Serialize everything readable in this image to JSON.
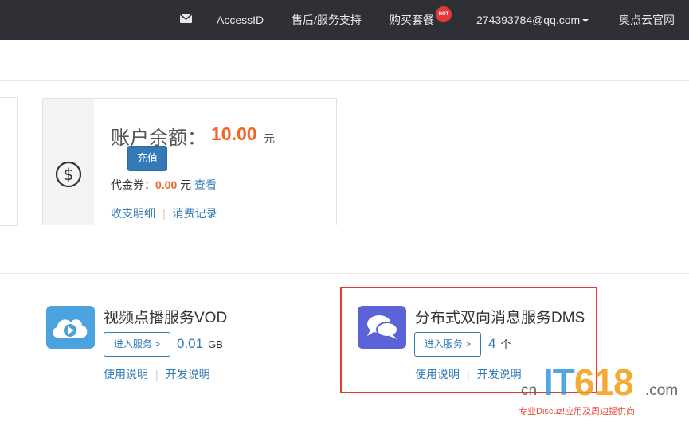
{
  "nav": {
    "mail_icon": "envelope-icon",
    "access_id": "AccessID",
    "support": "售后/服务支持",
    "buy": "购买套餐",
    "hot_badge": "HOT",
    "account": "274393784@qq.com",
    "official_site": "奥点云官网"
  },
  "balance": {
    "icon": "dollar-circle-icon",
    "label": "账户余额：",
    "amount": "10.00",
    "unit": "元",
    "recharge": "充值",
    "voucher_label": "代金券：",
    "voucher_amount": "0.00",
    "voucher_unit": "元",
    "voucher_view": "查看",
    "income_detail": "收支明细",
    "consume_record": "消费记录"
  },
  "services": [
    {
      "icon": "cloud-play-icon",
      "icon_color": "#4aa3df",
      "title": "视频点播服务VOD",
      "enter": "进入服务 >",
      "value": "0.01",
      "unit": "GB",
      "usage": "使用说明",
      "dev": "开发说明"
    },
    {
      "icon": "chat-bubbles-icon",
      "icon_color": "#5b63d6",
      "title": "分布式双向消息服务DMS",
      "enter": "进入服务 >",
      "value": "4",
      "unit": "个",
      "usage": "使用说明",
      "dev": "开发说明"
    }
  ],
  "watermark": {
    "cn": "cn",
    "it": "IT",
    "num": "618",
    "com": ".com",
    "sub": "专业Discuz!应用及周边提供商"
  }
}
